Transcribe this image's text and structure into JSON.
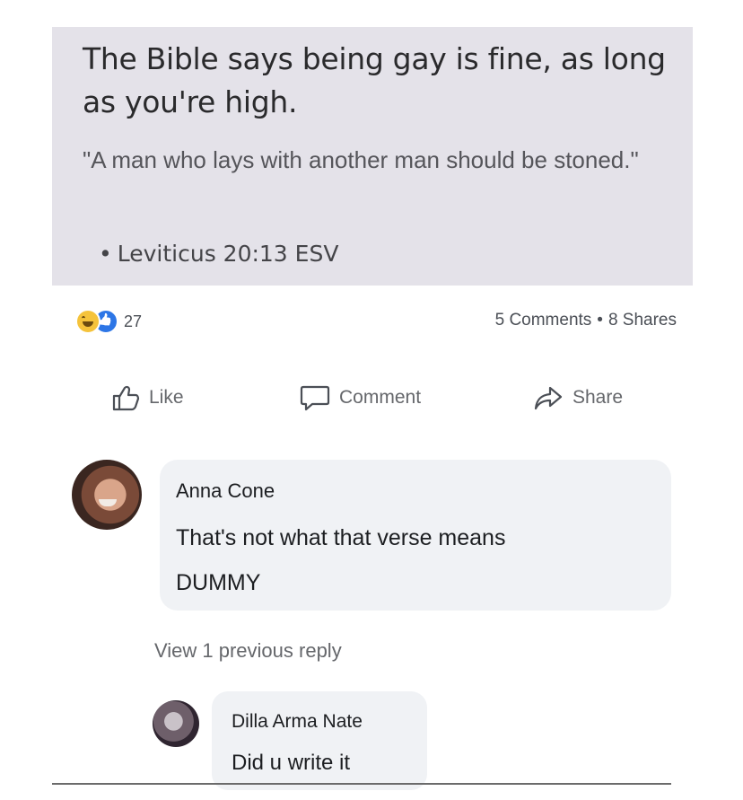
{
  "post": {
    "headline": "The Bible says being gay is fine, as long as you're high.",
    "quote": "\"A man who lays with another man should be stoned.\"",
    "citation": "Leviticus 20:13 ESV"
  },
  "stats": {
    "reaction_count": "27",
    "comments": "5 Comments",
    "separator": "•",
    "shares": "8 Shares",
    "reaction_icons": [
      "haha-reaction-icon",
      "like-reaction-icon"
    ]
  },
  "actions": {
    "like": "Like",
    "comment": "Comment",
    "share": "Share"
  },
  "comment": {
    "author": "Anna Cone",
    "text_line1": "That's not what that verse means",
    "text_line2": "DUMMY"
  },
  "view_previous": "View 1 previous reply",
  "reply": {
    "author": "Dilla Arma Nate",
    "text": "Did u write it"
  }
}
